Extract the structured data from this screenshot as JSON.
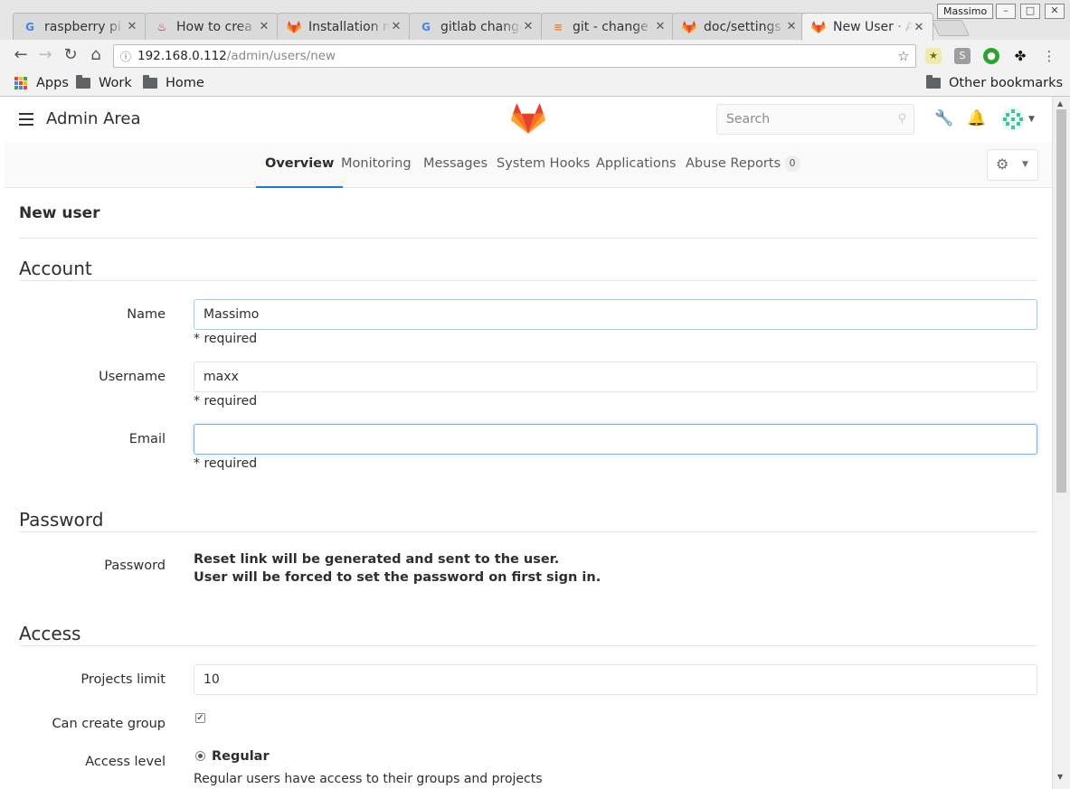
{
  "browser": {
    "tabs": [
      {
        "title": "raspberry pi",
        "icon": "google-icon"
      },
      {
        "title": "How to crea",
        "icon": "raspberry-icon"
      },
      {
        "title": "Installation m",
        "icon": "gitlab-icon"
      },
      {
        "title": "gitlab change",
        "icon": "google-icon"
      },
      {
        "title": "git - change",
        "icon": "stackoverflow-icon"
      },
      {
        "title": "doc/settings",
        "icon": "gitlab-icon"
      },
      {
        "title": "New User · A",
        "icon": "gitlab-icon"
      }
    ],
    "close_glyph": "✕",
    "window_user": "Massimo",
    "url_host": "192.168.0.112",
    "url_path": "/admin/users/new",
    "bookmarks": {
      "apps": "Apps",
      "work": "Work",
      "home": "Home",
      "other": "Other bookmarks"
    }
  },
  "header": {
    "title": "Admin Area",
    "search_placeholder": "Search"
  },
  "subnav": {
    "tabs": [
      "Overview",
      "Monitoring",
      "Messages",
      "System Hooks",
      "Applications",
      "Abuse Reports"
    ],
    "active": "Overview",
    "abuse_count": "0"
  },
  "page": {
    "title": "New user",
    "account_heading": "Account",
    "name_label": "Name",
    "name_value": "Massimo",
    "username_label": "Username",
    "username_value": "maxx",
    "email_label": "Email",
    "email_value": "",
    "required_text": "* required",
    "password_heading": "Password",
    "password_label": "Password",
    "password_line1": "Reset link will be generated and sent to the user.",
    "password_line2": "User will be forced to set the password on first sign in.",
    "access_heading": "Access",
    "projects_limit_label": "Projects limit",
    "projects_limit_value": "10",
    "can_create_group_label": "Can create group",
    "can_create_group_checked": true,
    "access_level_label": "Access level",
    "access_level_option": "Regular",
    "access_level_help": "Regular users have access to their groups and projects"
  },
  "colors": {
    "accent": "#1f78d1",
    "focus_border": "#73afea",
    "gitlab_orange": "#fc6d26"
  }
}
